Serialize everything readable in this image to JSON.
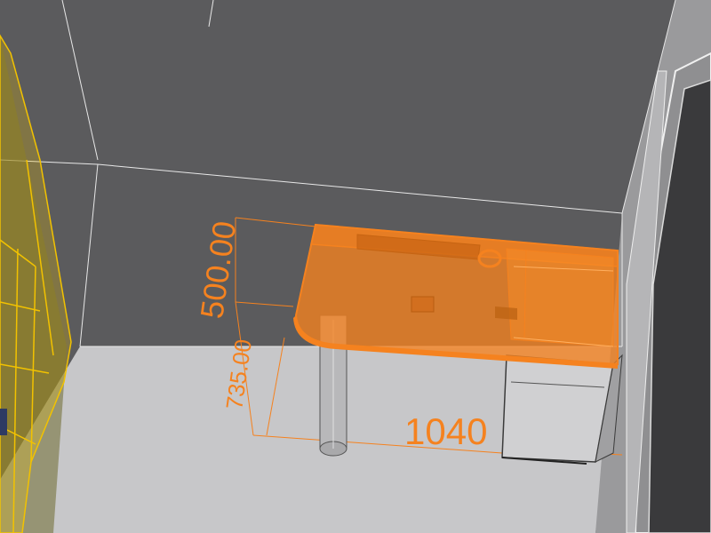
{
  "colors": {
    "background_wall": "#5a5a5c",
    "floor": "#c8c8ca",
    "selection": "#f5821f",
    "cabinet_highlight": "#f2c200"
  },
  "dimensions": {
    "width_label": "1040",
    "depth_label": "500.00",
    "height_label": "735.00"
  },
  "objects": {
    "desk_top": "selected-desk",
    "leg": "cylinder-leg",
    "drawer_unit": "drawer-cabinet",
    "bookcase": "highlighted-bookcase",
    "door": "door-frame"
  }
}
